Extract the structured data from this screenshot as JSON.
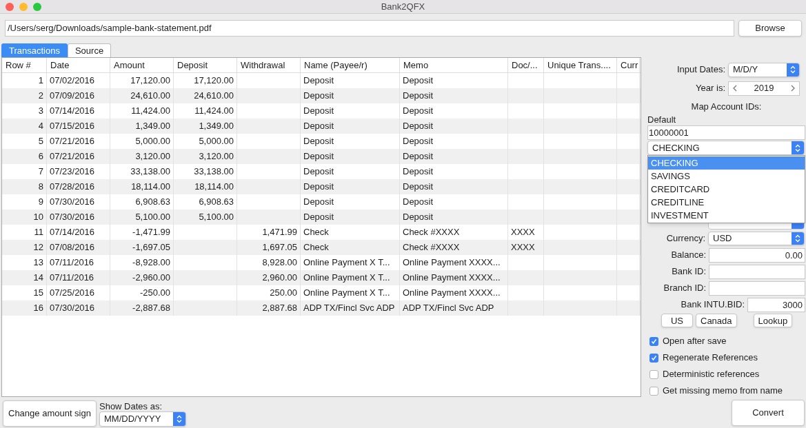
{
  "window": {
    "title": "Bank2QFX"
  },
  "file": {
    "path": "/Users/serg/Downloads/sample-bank-statement.pdf",
    "browse_button": "Browse"
  },
  "tabs": [
    {
      "label": "Transactions",
      "selected": true
    },
    {
      "label": "Source",
      "selected": false
    }
  ],
  "table": {
    "columns": [
      {
        "label": "Row #",
        "kind": "number"
      },
      {
        "label": "Date",
        "kind": "text"
      },
      {
        "label": "Amount",
        "kind": "number"
      },
      {
        "label": "Deposit",
        "kind": "number"
      },
      {
        "label": "Withdrawal",
        "kind": "number"
      },
      {
        "label": "Name (Payee/r)",
        "kind": "text"
      },
      {
        "label": "Memo",
        "kind": "text"
      },
      {
        "label": "Doc/...",
        "kind": "text"
      },
      {
        "label": "Unique Trans....",
        "kind": "text"
      },
      {
        "label": "Curr",
        "kind": "text"
      }
    ],
    "rows": [
      [
        "1",
        "07/02/2016",
        "17,120.00",
        "17,120.00",
        "",
        "Deposit",
        "Deposit",
        "",
        "",
        ""
      ],
      [
        "2",
        "07/09/2016",
        "24,610.00",
        "24,610.00",
        "",
        "Deposit",
        "Deposit",
        "",
        "",
        ""
      ],
      [
        "3",
        "07/14/2016",
        "11,424.00",
        "11,424.00",
        "",
        "Deposit",
        "Deposit",
        "",
        "",
        ""
      ],
      [
        "4",
        "07/15/2016",
        "1,349.00",
        "1,349.00",
        "",
        "Deposit",
        "Deposit",
        "",
        "",
        ""
      ],
      [
        "5",
        "07/21/2016",
        "5,000.00",
        "5,000.00",
        "",
        "Deposit",
        "Deposit",
        "",
        "",
        ""
      ],
      [
        "6",
        "07/21/2016",
        "3,120.00",
        "3,120.00",
        "",
        "Deposit",
        "Deposit",
        "",
        "",
        ""
      ],
      [
        "7",
        "07/23/2016",
        "33,138.00",
        "33,138.00",
        "",
        "Deposit",
        "Deposit",
        "",
        "",
        ""
      ],
      [
        "8",
        "07/28/2016",
        "18,114.00",
        "18,114.00",
        "",
        "Deposit",
        "Deposit",
        "",
        "",
        ""
      ],
      [
        "9",
        "07/30/2016",
        "6,908.63",
        "6,908.63",
        "",
        "Deposit",
        "Deposit",
        "",
        "",
        ""
      ],
      [
        "10",
        "07/30/2016",
        "5,100.00",
        "5,100.00",
        "",
        "Deposit",
        "Deposit",
        "",
        "",
        ""
      ],
      [
        "11",
        "07/14/2016",
        "-1,471.99",
        "",
        "1,471.99",
        "Check",
        "Check #XXXX",
        "XXXX",
        "",
        ""
      ],
      [
        "12",
        "07/08/2016",
        "-1,697.05",
        "",
        "1,697.05",
        "Check",
        "Check #XXXX",
        "XXXX",
        "",
        ""
      ],
      [
        "13",
        "07/11/2016",
        "-8,928.00",
        "",
        "8,928.00",
        "Online Payment X T...",
        "Online Payment XXXX...",
        "",
        "",
        ""
      ],
      [
        "14",
        "07/11/2016",
        "-2,960.00",
        "",
        "2,960.00",
        "Online Payment X T...",
        "Online Payment XXXX...",
        "",
        "",
        ""
      ],
      [
        "15",
        "07/25/2016",
        "-250.00",
        "",
        "250.00",
        "Online Payment X T...",
        "Online Payment XXXX...",
        "",
        "",
        ""
      ],
      [
        "16",
        "07/30/2016",
        "-2,887.68",
        "",
        "2,887.68",
        "ADP TX/Fincl Svc ADP",
        "ADP TX/Fincl Svc ADP",
        "",
        "",
        ""
      ]
    ]
  },
  "settings": {
    "input_dates": {
      "label": "Input Dates:",
      "value": "M/D/Y"
    },
    "year": {
      "label": "Year is:",
      "value": "2019"
    },
    "map_title": "Map Account IDs:",
    "default_label": "Default",
    "account_id": "10000001",
    "account_type": "CHECKING",
    "account_type_options": [
      {
        "label": "CHECKING",
        "selected": true
      },
      {
        "label": "SAVINGS",
        "selected": false
      },
      {
        "label": "CREDITCARD",
        "selected": false
      },
      {
        "label": "CREDITLINE",
        "selected": false
      },
      {
        "label": "INVESTMENT",
        "selected": false
      }
    ],
    "currency": {
      "label": "Currency:",
      "value": "USD"
    },
    "balance": {
      "label": "Balance:",
      "value": "0.00"
    },
    "bank_id": {
      "label": "Bank ID:"
    },
    "branch_id": {
      "label": "Branch ID:"
    },
    "bank_intu_bid": {
      "label": "Bank INTU.BID:",
      "value": "3000"
    },
    "buttons": [
      "US",
      "Canada",
      "Lookup"
    ],
    "checkboxes": [
      {
        "label": "Open after save",
        "checked": true
      },
      {
        "label": "Regenerate References",
        "checked": true
      },
      {
        "label": "Deterministic references",
        "checked": false
      },
      {
        "label": "Get missing memo from name",
        "checked": false
      }
    ],
    "convert_button": "Convert"
  },
  "bottom": {
    "change_sign_button": "Change amount sign",
    "show_dates": {
      "label": "Show Dates as:",
      "value": "MM/DD/YYYY"
    }
  }
}
